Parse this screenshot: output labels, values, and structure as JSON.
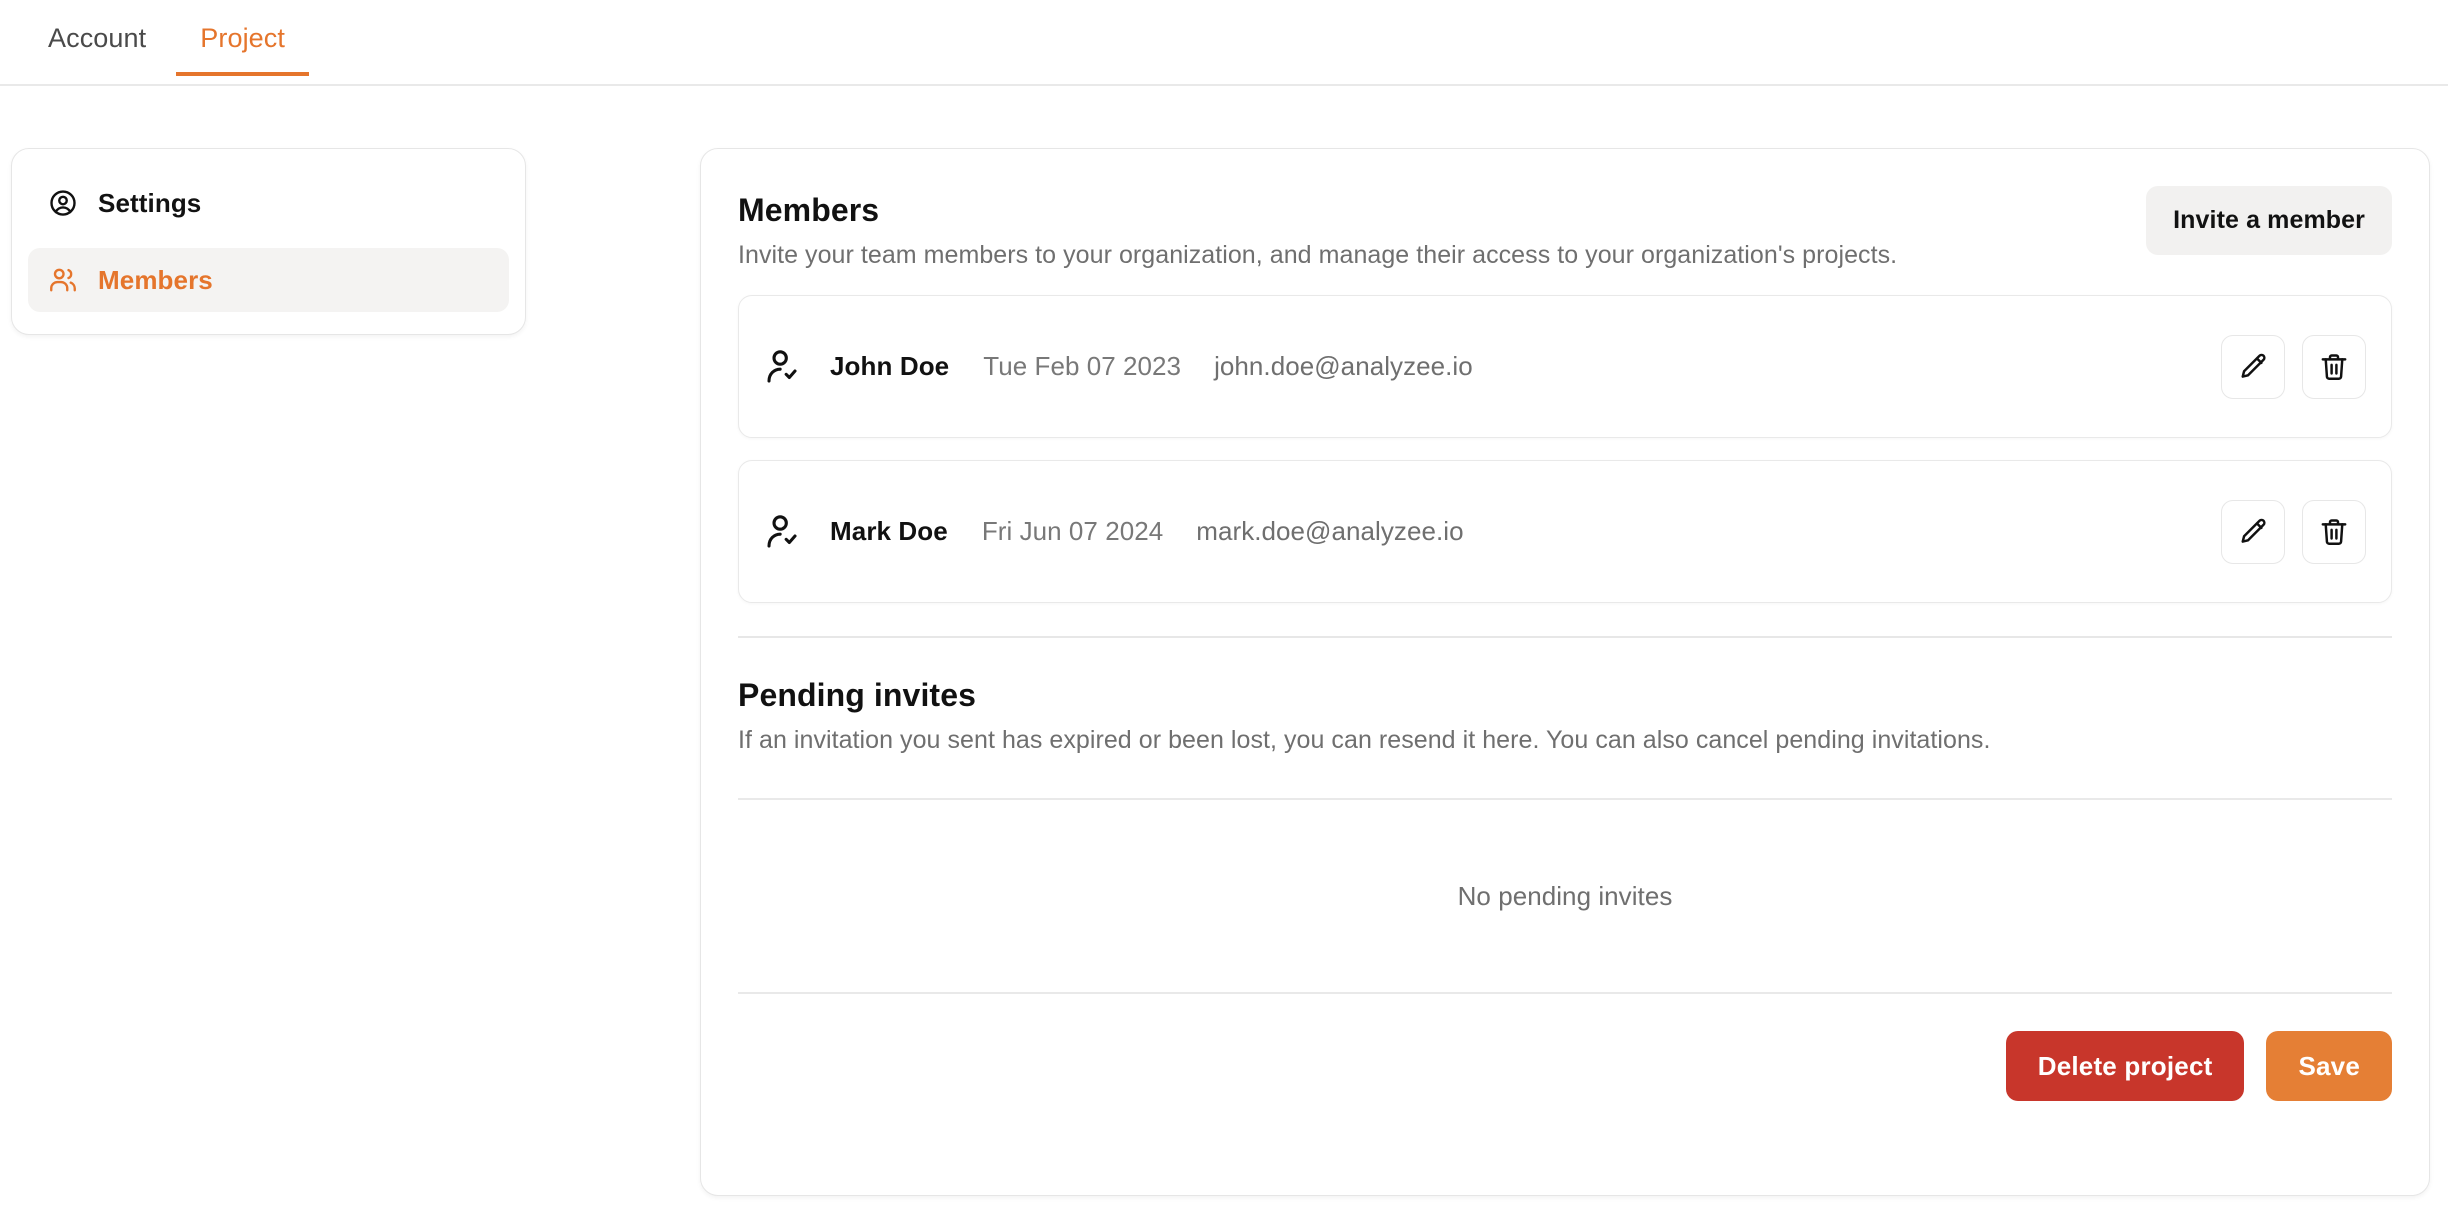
{
  "tabs": [
    {
      "label": "Account",
      "active": false
    },
    {
      "label": "Project",
      "active": true
    }
  ],
  "sidebar": {
    "items": [
      {
        "label": "Settings",
        "icon": "user-circle-icon",
        "active": false
      },
      {
        "label": "Members",
        "icon": "users-icon",
        "active": true
      }
    ]
  },
  "members_section": {
    "title": "Members",
    "description": "Invite your team members to your organization, and manage their access to your organization's projects.",
    "invite_button": "Invite a member",
    "columns": [
      "name",
      "joined_date",
      "email"
    ],
    "rows": [
      {
        "icon": "user-check-icon",
        "name": "John Doe",
        "date": "Tue Feb 07 2023",
        "email": "john.doe@analyzee.io",
        "edit_icon": "pencil-icon",
        "delete_icon": "trash-icon"
      },
      {
        "icon": "user-check-icon",
        "name": "Mark Doe",
        "date": "Fri Jun 07 2024",
        "email": "mark.doe@analyzee.io",
        "edit_icon": "pencil-icon",
        "delete_icon": "trash-icon"
      }
    ]
  },
  "pending_section": {
    "title": "Pending invites",
    "description": "If an invitation you sent has expired or been lost, you can resend it here. You can also cancel pending invitations.",
    "empty_text": "No pending invites"
  },
  "footer": {
    "delete_label": "Delete project",
    "save_label": "Save"
  },
  "colors": {
    "accent_orange": "#e5752c",
    "save_orange": "#e57f35",
    "danger_red": "#c8362b",
    "active_bg": "#f4f3f2",
    "muted_text": "#6f6f6f",
    "border": "#e6e6e6"
  }
}
